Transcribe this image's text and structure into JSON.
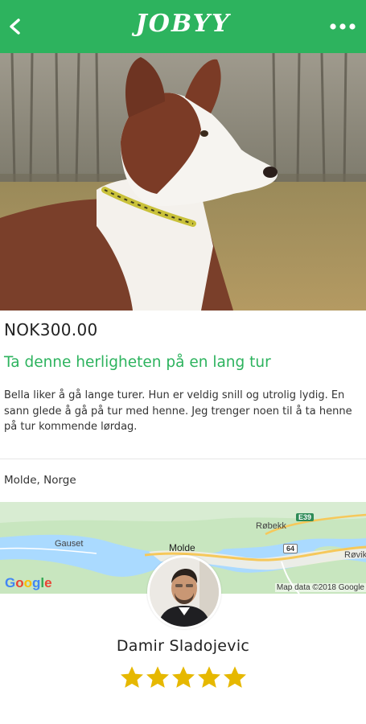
{
  "header": {
    "logo_text": "JOBYY",
    "back_icon": "chevron-left-icon",
    "menu_icon": "more-dots-icon",
    "color": "#2db35e"
  },
  "listing": {
    "price": "NOK300.00",
    "title": "Ta denne herligheten på en lang tur",
    "description": "Bella liker å gå lange turer. Hun er veldig snill og utrolig lydig. En sann glede å gå på tur med henne. Jeg trenger noen til å ta henne på tur kommende lørdag.",
    "location": "Molde, Norge"
  },
  "map": {
    "labels": {
      "gauset": "Gauset",
      "molde": "Molde",
      "robekk": "Røbekk",
      "rovik": "Røvik"
    },
    "shields": {
      "e39": "E39",
      "r64": "64"
    },
    "credit": "Map data ©2018 Google",
    "google_logo": "Google"
  },
  "user": {
    "name": "Damir Sladojevic",
    "rating": 5,
    "star_color": "#e6b800"
  }
}
